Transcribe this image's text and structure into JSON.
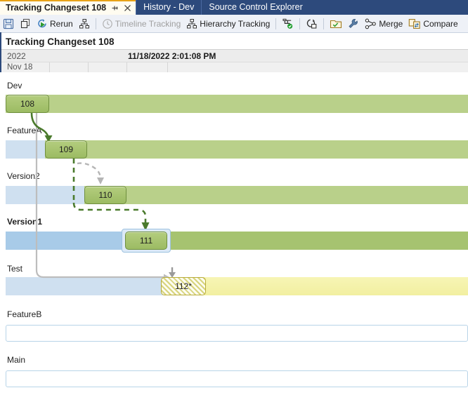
{
  "window": {
    "tabs": [
      {
        "label": "Tracking Changeset 108",
        "active": true,
        "pin_icon": "pin-icon",
        "close_icon": "close-icon"
      },
      {
        "label": "History - Dev",
        "active": false
      },
      {
        "label": "Source Control Explorer",
        "active": false
      }
    ]
  },
  "toolbar": {
    "items": [
      {
        "name": "save-button",
        "icon": "save-icon",
        "label": ""
      },
      {
        "name": "copy-button",
        "icon": "copy-icon",
        "label": ""
      },
      {
        "name": "rerun-button",
        "icon": "rerun-icon",
        "label": "Rerun"
      },
      {
        "name": "layout-button",
        "icon": "hierarchy-icon",
        "label": ""
      },
      {
        "name": "timeline-tracking-button",
        "icon": "clock-icon",
        "label": "Timeline Tracking",
        "disabled": true
      },
      {
        "name": "hierarchy-tracking-button",
        "icon": "hierarchy-icon",
        "label": "Hierarchy Tracking"
      },
      {
        "name": "show-changesets-button",
        "icon": "checked-branch-icon",
        "label": ""
      },
      {
        "name": "show-merges-button",
        "icon": "merge-view-icon",
        "label": ""
      },
      {
        "name": "open-folder-button",
        "icon": "folder-check-icon",
        "label": ""
      },
      {
        "name": "settings-button",
        "icon": "wrench-icon",
        "label": ""
      },
      {
        "name": "merge-button",
        "icon": "merge-icon",
        "label": "Merge"
      },
      {
        "name": "compare-button",
        "icon": "compare-icon",
        "label": "Compare"
      }
    ]
  },
  "page": {
    "title": "Tracking Changeset 108"
  },
  "date_header": {
    "year": "2022",
    "day": "Nov 18",
    "timestamp": "11/18/2022 2:01:08 PM"
  },
  "graph": {
    "branches": [
      {
        "name": "Dev",
        "selected": false,
        "kind": "green",
        "changeset": "108"
      },
      {
        "name": "FeatureA",
        "selected": false,
        "kind": "blue-green",
        "changeset": "109"
      },
      {
        "name": "Version2",
        "selected": false,
        "kind": "blue-green",
        "changeset": "110"
      },
      {
        "name": "Version1",
        "selected": true,
        "kind": "blue-green",
        "changeset": "111"
      },
      {
        "name": "Test",
        "selected": false,
        "kind": "blue-yellow",
        "changeset": "112*"
      },
      {
        "name": "FeatureB",
        "selected": false,
        "kind": "empty",
        "changeset": ""
      },
      {
        "name": "Main",
        "selected": false,
        "kind": "empty",
        "changeset": ""
      }
    ]
  },
  "colors": {
    "accent_tab": "#e8a317",
    "tabstrip": "#2d4a7c",
    "node_green": "#a6c370",
    "lane_blue": "#cfe0f0",
    "lane_green": "#b9d08a",
    "lane_yellow": "#f2efa0",
    "branch_arrow_green": "#4a6b28",
    "merge_arrow_gray": "#9a9a9a"
  }
}
